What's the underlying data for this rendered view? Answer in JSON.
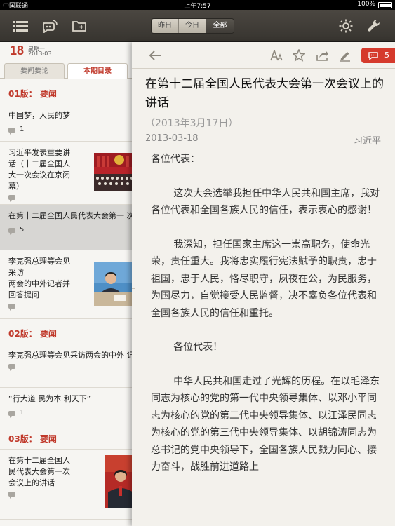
{
  "status_bar": {
    "carrier": "中国联通",
    "time": "上午7:57",
    "battery": "100%"
  },
  "toolbar": {
    "icons": [
      "menu-icon",
      "rss-icon",
      "folder-icon",
      "brightness-icon",
      "wrench-icon"
    ],
    "segments": [
      {
        "label": "昨日",
        "active": false
      },
      {
        "label": "今日",
        "active": false
      },
      {
        "label": "全部",
        "active": true
      }
    ]
  },
  "left_panel": {
    "date": {
      "day": "18",
      "weekday": "星期一",
      "year_month": "2013-03"
    },
    "tabs": [
      {
        "label": "要闻要论",
        "active": false
      },
      {
        "label": "本期目录",
        "active": true
      }
    ],
    "sections": [
      {
        "label": "01版：  要闻",
        "items": [
          {
            "title": "中国梦，人民的梦",
            "comments": "1",
            "thumb": "",
            "selected": false
          },
          {
            "title": "习近平发表重要讲\n话（十二届全国人\n大一次会议在京闭\n幕）",
            "comments": "",
            "thumb": "congress-hall",
            "selected": false
          },
          {
            "title": "在第十二届全国人民代表大会第一\n次会议上的讲话",
            "comments": "5",
            "thumb": "",
            "selected": true
          },
          {
            "title": "李克强总理等会见\n采访\n两会的中外记者并\n回答提问",
            "comments": "",
            "thumb": "premier",
            "selected": false
          }
        ]
      },
      {
        "label": "02版：  要闻",
        "items": [
          {
            "title": "李克强总理等会见采访两会的中外\n记者并回答提问",
            "comments": "",
            "thumb": "",
            "selected": false
          },
          {
            "title": "“行大道    民为本    利天下”",
            "comments": "1",
            "thumb": "",
            "selected": false
          }
        ]
      },
      {
        "label": "03版：  要闻",
        "items": [
          {
            "title": "在第十二届全国人\n民代表大会第一次\n会议上的讲话",
            "comments": "",
            "thumb": "president",
            "selected": false
          }
        ]
      }
    ]
  },
  "article": {
    "toolbar_icons": [
      "back-arrow-icon",
      "font-size-icon",
      "star-icon",
      "share-icon",
      "edit-icon"
    ],
    "comment_count": "5",
    "title": "在第十二届全国人民代表大会第一次会议上的讲话",
    "subtitle": "（2013年3月17日）",
    "date": "2013-03-18",
    "author": "习近平",
    "paragraphs": [
      "各位代表：",
      "这次大会选举我担任中华人民共和国主席，我对各位代表和全国各族人民的信任，表示衷心的感谢！",
      "我深知，担任国家主席这一崇高职务，使命光荣，责任重大。我将忠实履行宪法赋予的职责，忠于祖国，忠于人民，恪尽职守，夙夜在公，为民服务，为国尽力，自觉接受人民监督，决不辜负各位代表和全国各族人民的信任和重托。",
      "各位代表！",
      "中华人民共和国走过了光辉的历程。在以毛泽东同志为核心的党的第一代中央领导集体、以邓小平同志为核心的党的第二代中央领导集体、以江泽民同志为核心的党的第三代中央领导集体、以胡锦涛同志为总书记的党中央领导下，全国各族人民戮力同心、接力奋斗，战胜前进道路上"
    ]
  },
  "colors": {
    "accent": "#c0392b",
    "badge": "#d53a2c",
    "toolbar": "#3f3c37"
  }
}
